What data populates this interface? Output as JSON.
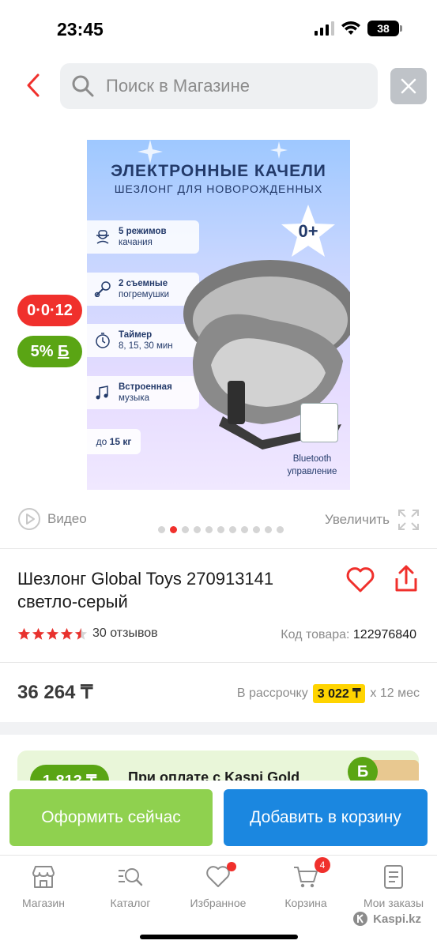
{
  "status_bar": {
    "time": "23:45",
    "battery": "38"
  },
  "header": {
    "search_placeholder": "Поиск в Магазине"
  },
  "product_image": {
    "title": "ЭЛЕКТРОННЫЕ КАЧЕЛИ",
    "subtitle": "ШЕЗЛОНГ ДЛЯ НОВОРОЖДЕННЫХ",
    "age": "0+",
    "features": [
      {
        "bold": "5 режимов",
        "text": "качания",
        "icon": "cradle-icon"
      },
      {
        "bold": "2 съемные",
        "text": "погремушки",
        "icon": "rattle-icon"
      },
      {
        "bold": "Таймер",
        "text": "8, 15, 30 мин",
        "icon": "timer-icon"
      },
      {
        "bold": "Встроенная",
        "text": "музыка",
        "icon": "music-icon"
      }
    ],
    "weight_prefix": "до",
    "weight_value": "15 кг",
    "bluetooth_line1": "Bluetooth",
    "bluetooth_line2": "управление"
  },
  "badges": {
    "installment": "0·0·12",
    "bonus_value": "5%",
    "bonus_symbol": "Б"
  },
  "media": {
    "video_label": "Видео",
    "zoom_label": "Увеличить",
    "dots_total": 11,
    "active_dot": 1
  },
  "product": {
    "title": "Шезлонг Global Toys 270913141 светло-серый",
    "rating": 4.5,
    "reviews": "30 отзывов",
    "sku_label": "Код товара:",
    "sku_value": "122976840",
    "price": "36 264 ₸",
    "installment_label": "В рассрочку",
    "installment_amount": "3 022 ₸",
    "installment_term": "х 12 мес"
  },
  "promo": {
    "badge": "1 813 ₸",
    "text": "При оплате с Kaspi Gold",
    "icon_symbol": "Б"
  },
  "actions": {
    "buy_now": "Оформить сейчас",
    "add_to_cart": "Добавить в корзину"
  },
  "bottom_nav": {
    "items": [
      {
        "label": "Магазин",
        "icon": "store-icon"
      },
      {
        "label": "Каталог",
        "icon": "catalog-search-icon"
      },
      {
        "label": "Избранное",
        "icon": "heart-icon"
      },
      {
        "label": "Корзина",
        "icon": "cart-icon",
        "count": "4"
      },
      {
        "label": "Мои заказы",
        "icon": "orders-icon"
      }
    ]
  },
  "watermark": "Kaspi.kz",
  "colors": {
    "accent_red": "#f0302c",
    "bonus_green": "#5aa514",
    "buy_green": "#8fd14f",
    "cart_blue": "#1b87e0",
    "installment_yellow": "#ffd400"
  }
}
